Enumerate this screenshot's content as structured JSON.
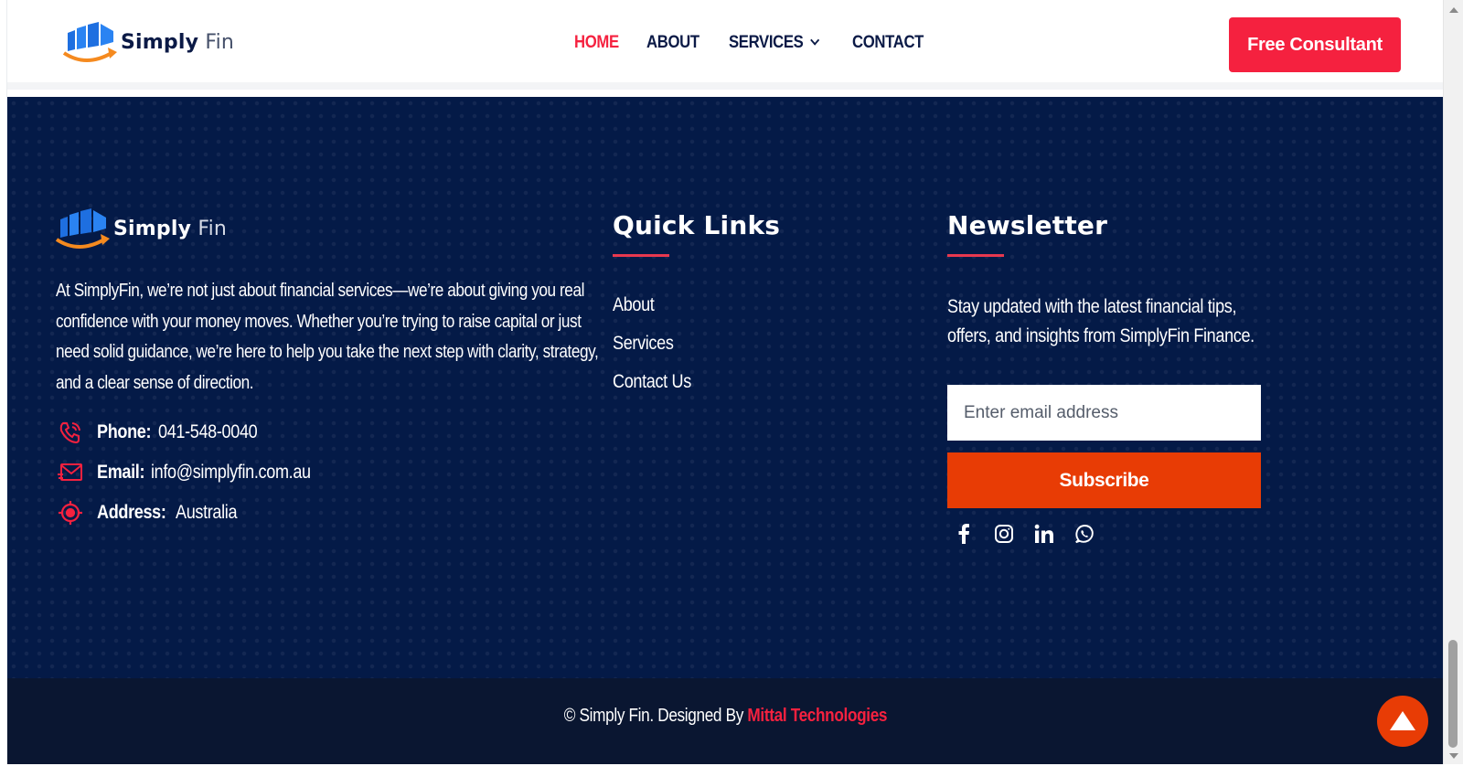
{
  "brand": {
    "name_bold": "Simply",
    "name_light": "Fin"
  },
  "nav": {
    "items": [
      {
        "label": "HOME",
        "active": true
      },
      {
        "label": "ABOUT",
        "active": false
      },
      {
        "label": "SERVICES",
        "active": false,
        "has_dropdown": true
      },
      {
        "label": "CONTACT",
        "active": false
      }
    ],
    "cta_label": "Free Consultant"
  },
  "footer": {
    "about_text": "At SimplyFin, we’re not just about financial services—we’re about giving you real confidence with your money moves. Whether you’re trying to raise capital or just need solid guidance, we’re here to help you take the next step with clarity, strategy, and a clear sense of direction.",
    "contact": {
      "phone_label": "Phone:",
      "phone_value": "041-548-0040",
      "email_label": "Email:",
      "email_value": "info@simplyfin.com.au",
      "address_label": "Address:",
      "address_value": "Australia"
    },
    "quick_links": {
      "title": "Quick Links",
      "items": [
        "About",
        "Services",
        "Contact Us"
      ]
    },
    "newsletter": {
      "title": "Newsletter",
      "text": "Stay updated with the latest financial tips, offers, and insights from SimplyFin Finance.",
      "email_placeholder": "Enter email address",
      "subscribe_label": "Subscribe"
    },
    "social_icons": [
      "facebook-icon",
      "instagram-icon",
      "linkedin-icon",
      "whatsapp-icon"
    ]
  },
  "bottom_bar": {
    "copyright_prefix": "© Simply Fin. Designed By ",
    "designer": "Mittal Technologies"
  },
  "colors": {
    "accent": "#f5213f",
    "orange": "#e83c05",
    "navy": "#041a47",
    "bottom_bar": "#0a1631"
  }
}
